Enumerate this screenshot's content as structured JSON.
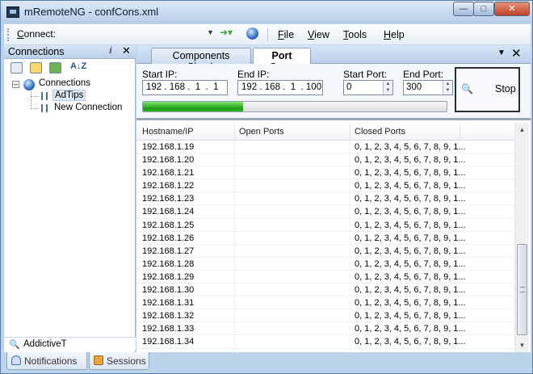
{
  "window": {
    "title": "mRemoteNG - confCons.xml"
  },
  "toolbar": {
    "connect_label_underlined": "C",
    "connect_label_rest": "onnect:",
    "connect_value": ""
  },
  "menu": [
    {
      "ul": "F",
      "rest": "ile"
    },
    {
      "ul": "V",
      "rest": "iew"
    },
    {
      "ul": "T",
      "rest": "ools"
    },
    {
      "ul": "H",
      "rest": "elp"
    }
  ],
  "connections_panel": {
    "title": "Connections",
    "pin_glyph": "ⅈ",
    "close_glyph": "✕",
    "sort_glyph": "A↓Z",
    "tree_root": "Connections",
    "tree_items": [
      "AdTips",
      "New Connection"
    ],
    "search_value": "AddictiveT"
  },
  "tabs": {
    "components_check": "Components Check",
    "port_scan": "Port Scan"
  },
  "port_scan": {
    "start_ip_label": "Start IP:",
    "start_ip_value": "192 . 168 .  1  .  1",
    "end_ip_label": "End IP:",
    "end_ip_value": "192 . 168 .  1  . 100",
    "start_port_label": "Start Port:",
    "start_port_value": "0",
    "end_port_label": "End Port:",
    "end_port_value": "300",
    "progress_fraction": 0.33,
    "stop_label": "Stop"
  },
  "results": {
    "columns": [
      "Hostname/IP",
      "Open Ports",
      "Closed Ports"
    ],
    "rows": [
      [
        "192.168.1.19",
        "",
        "0, 1, 2, 3, 4, 5, 6, 7, 8, 9, 1..."
      ],
      [
        "192.168.1.20",
        "",
        "0, 1, 2, 3, 4, 5, 6, 7, 8, 9, 1..."
      ],
      [
        "192.168.1.21",
        "",
        "0, 1, 2, 3, 4, 5, 6, 7, 8, 9, 1..."
      ],
      [
        "192.168.1.22",
        "",
        "0, 1, 2, 3, 4, 5, 6, 7, 8, 9, 1..."
      ],
      [
        "192.168.1.23",
        "",
        "0, 1, 2, 3, 4, 5, 6, 7, 8, 9, 1..."
      ],
      [
        "192.168.1.24",
        "",
        "0, 1, 2, 3, 4, 5, 6, 7, 8, 9, 1..."
      ],
      [
        "192.168.1.25",
        "",
        "0, 1, 2, 3, 4, 5, 6, 7, 8, 9, 1..."
      ],
      [
        "192.168.1.26",
        "",
        "0, 1, 2, 3, 4, 5, 6, 7, 8, 9, 1..."
      ],
      [
        "192.168.1.27",
        "",
        "0, 1, 2, 3, 4, 5, 6, 7, 8, 9, 1..."
      ],
      [
        "192.168.1.28",
        "",
        "0, 1, 2, 3, 4, 5, 6, 7, 8, 9, 1..."
      ],
      [
        "192.168.1.29",
        "",
        "0, 1, 2, 3, 4, 5, 6, 7, 8, 9, 1..."
      ],
      [
        "192.168.1.30",
        "",
        "0, 1, 2, 3, 4, 5, 6, 7, 8, 9, 1..."
      ],
      [
        "192.168.1.31",
        "",
        "0, 1, 2, 3, 4, 5, 6, 7, 8, 9, 1..."
      ],
      [
        "192.168.1.32",
        "",
        "0, 1, 2, 3, 4, 5, 6, 7, 8, 9, 1..."
      ],
      [
        "192.168.1.33",
        "",
        "0, 1, 2, 3, 4, 5, 6, 7, 8, 9, 1..."
      ],
      [
        "192.168.1.34",
        "",
        "0, 1, 2, 3, 4, 5, 6, 7, 8, 9, 1..."
      ]
    ]
  },
  "bottom_tabs": [
    "Notifications",
    "Sessions"
  ],
  "colors": {
    "progress_green": "#1d9c16",
    "title_close_red": "#c0422a",
    "frame_blue": "#bcd3ec"
  }
}
